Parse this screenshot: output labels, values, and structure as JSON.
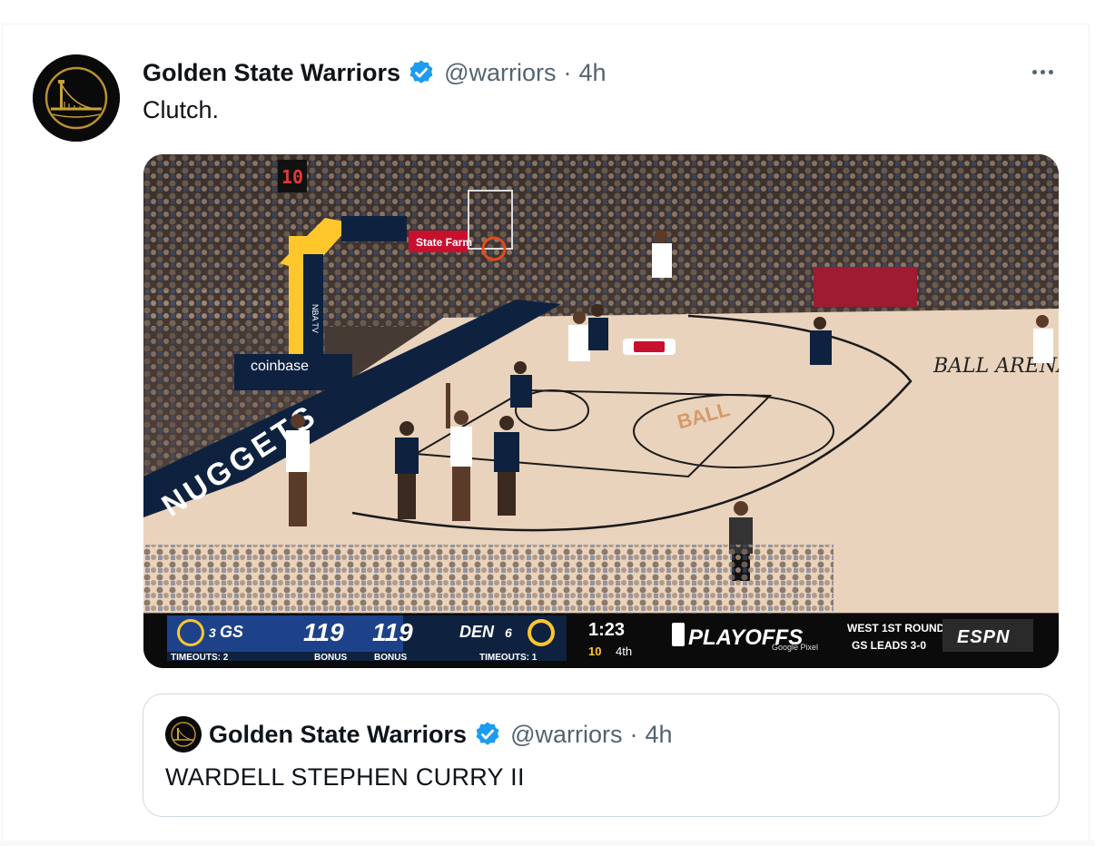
{
  "tweet": {
    "author_name": "Golden State Warriors",
    "handle": "@warriors",
    "separator": "·",
    "time": "4h",
    "text": "Clutch."
  },
  "media": {
    "description_icon": "basketball-video-frame",
    "scoreboard": {
      "away_seed": "3",
      "away_team": "GS",
      "away_score": "119",
      "away_timeouts": "TIMEOUTS: 2",
      "away_bonus": "BONUS",
      "home_score": "119",
      "home_bonus": "BONUS",
      "home_team": "DEN",
      "home_seed": "6",
      "home_timeouts": "TIMEOUTS: 1",
      "clock": "1:23",
      "shot_clock": "10",
      "quarter": "4th",
      "event": "PLAYOFFS",
      "sponsor": "Google Pixel",
      "series_line1": "WEST 1ST ROUND",
      "series_line2": "GS LEADS 3-0",
      "network": "ESPN"
    },
    "court_text": {
      "baseline": "BALL ARENA",
      "sideline_sponsor": "coinbase",
      "stanchion": "NBA TV",
      "banner": "State Farm",
      "clock": "10"
    },
    "colors": {
      "warriors_blue": "#1d428a",
      "warriors_gold": "#ffc72c",
      "nuggets_navy": "#0e2240",
      "court": "#e9d3bd",
      "verified": "#1d9bf0"
    }
  },
  "quoted_tweet": {
    "author_name": "Golden State Warriors",
    "handle": "@warriors",
    "separator": "·",
    "time": "4h",
    "text": "WARDELL STEPHEN CURRY II"
  }
}
